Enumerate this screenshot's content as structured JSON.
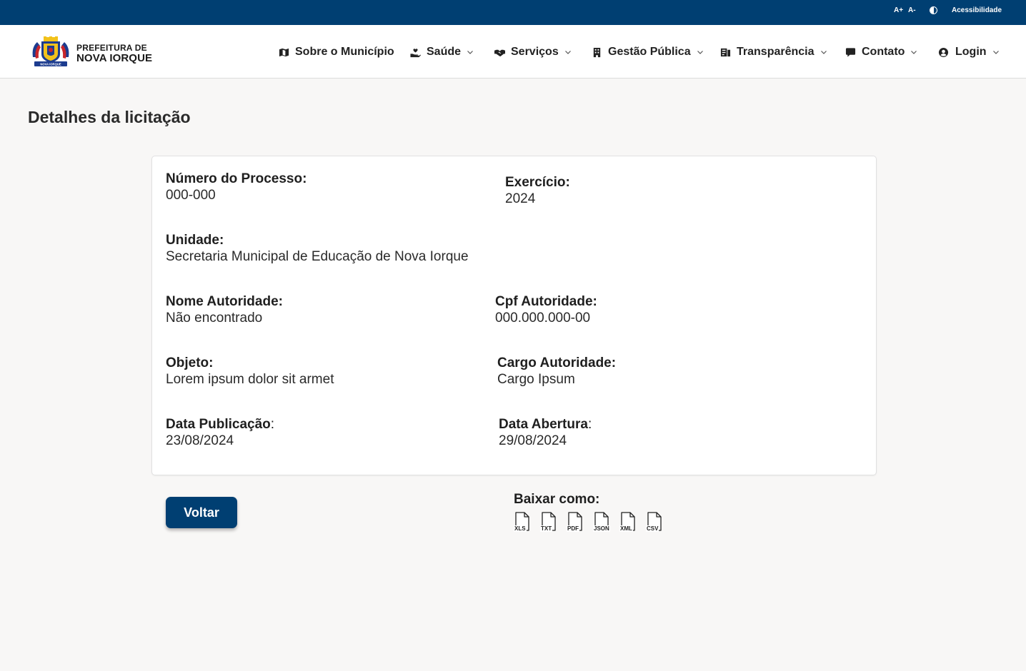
{
  "topbar": {
    "font_increase": "A+",
    "font_decrease": "A-",
    "contrast_icon": "contrast-icon",
    "accessibility": "Acessibilidade"
  },
  "brand": {
    "line1": "PREFEITURA DE",
    "line2": "NOVA IORQUE",
    "emblem_text": "NOVA IORQUE"
  },
  "nav": {
    "items": [
      {
        "label": "Sobre o Município",
        "icon": "map-icon",
        "has_dropdown": false
      },
      {
        "label": "Saúde",
        "icon": "hand-heart-icon",
        "has_dropdown": true
      },
      {
        "label": "Serviços",
        "icon": "handshake-icon",
        "has_dropdown": true
      },
      {
        "label": "Gestão Pública",
        "icon": "building-icon",
        "has_dropdown": true
      },
      {
        "label": "Transparência",
        "icon": "document-icon",
        "has_dropdown": true
      },
      {
        "label": "Contato",
        "icon": "chat-icon",
        "has_dropdown": true
      },
      {
        "label": "Login",
        "icon": "user-circle-icon",
        "has_dropdown": true
      }
    ]
  },
  "page": {
    "title": "Detalhes da licitação"
  },
  "details": {
    "numero_processo": {
      "label": "Número do Processo:",
      "value": "000-000"
    },
    "exercicio": {
      "label": "Exercício:",
      "value": "2024"
    },
    "unidade": {
      "label": "Unidade:",
      "value": "Secretaria Municipal de Educação de Nova Iorque"
    },
    "nome_autoridade": {
      "label": "Nome Autoridade:",
      "value": "Não encontrado"
    },
    "cpf_autoridade": {
      "label": "Cpf Autoridade:",
      "value": "000.000.000-00"
    },
    "objeto": {
      "label": "Objeto:",
      "value": "Lorem ipsum dolor sit armet"
    },
    "cargo_autoridade": {
      "label": "Cargo Autoridade:",
      "value": "Cargo Ipsum"
    },
    "data_publicacao": {
      "label": "Data Publicação",
      "colon": ":",
      "value": "23/08/2024"
    },
    "data_abertura": {
      "label": "Data Abertura",
      "colon": ":",
      "value": "29/08/2024"
    }
  },
  "actions": {
    "back_label": "Voltar",
    "download_label": "Baixar como:",
    "formats": [
      "XLS",
      "TXT",
      "PDF",
      "JSON",
      "XML",
      "CSV"
    ]
  },
  "colors": {
    "primary": "#003f72",
    "background": "#f8f7f6",
    "emblem_blue": "#1d3c8f",
    "emblem_gold": "#f2c21b",
    "emblem_red": "#c8262c"
  }
}
